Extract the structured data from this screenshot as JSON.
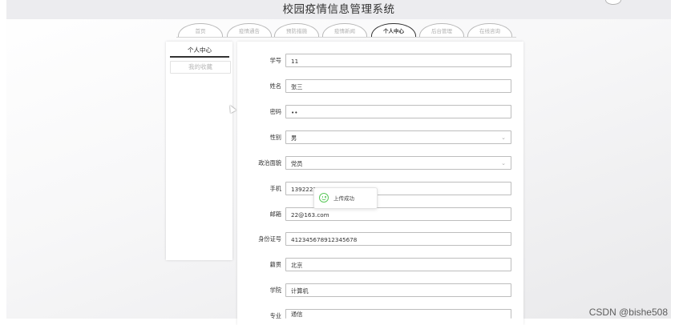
{
  "app": {
    "title": "校园疫情信息管理系统"
  },
  "nav": {
    "tabs": [
      {
        "label": "首页",
        "active": false
      },
      {
        "label": "疫情通告",
        "active": false
      },
      {
        "label": "预防措施",
        "active": false
      },
      {
        "label": "疫情新闻",
        "active": false
      },
      {
        "label": "个人中心",
        "active": true
      },
      {
        "label": "后台管理",
        "active": false
      },
      {
        "label": "在线咨询",
        "active": false
      }
    ]
  },
  "sidebar": {
    "items": [
      {
        "label": "个人中心",
        "active": true
      },
      {
        "label": "我的收藏",
        "active": false
      }
    ]
  },
  "form": {
    "student_id": {
      "label": "学号",
      "value": "11"
    },
    "name": {
      "label": "姓名",
      "value": "张三"
    },
    "password": {
      "label": "密码",
      "value": "••"
    },
    "gender": {
      "label": "性别",
      "value": "男"
    },
    "political_status": {
      "label": "政治面貌",
      "value": "党员"
    },
    "phone": {
      "label": "手机",
      "value": "13922222222"
    },
    "email": {
      "label": "邮箱",
      "value": "22@163.com"
    },
    "id_card": {
      "label": "身份证号",
      "value": "412345678912345678"
    },
    "hometown": {
      "label": "籍贯",
      "value": "北京"
    },
    "college": {
      "label": "学院",
      "value": "计算机"
    },
    "major": {
      "label": "专业",
      "value": "通信"
    }
  },
  "toast": {
    "message": "上传成功",
    "icon": "smile-icon",
    "color": "#5ac85a"
  },
  "watermark": "CSDN @bishe508"
}
